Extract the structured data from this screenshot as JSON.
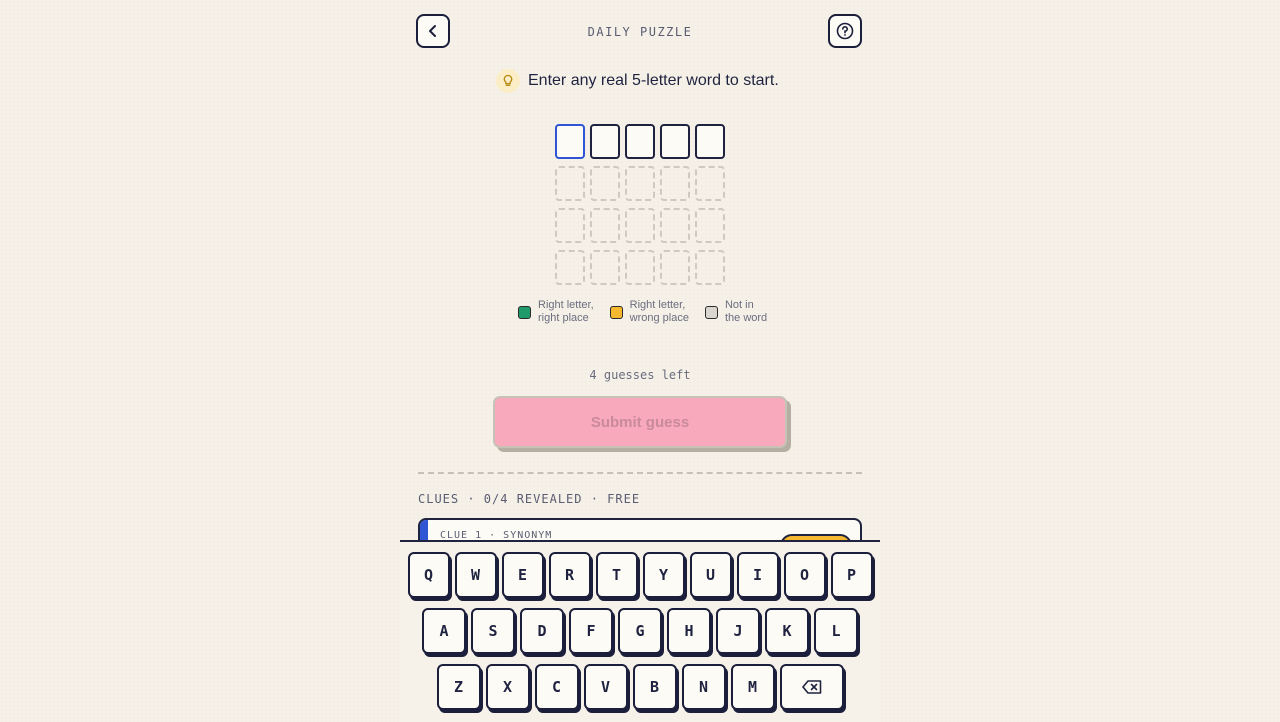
{
  "header": {
    "title": "DAILY PUZZLE",
    "back_icon": "chevron-left-icon",
    "help_icon": "question-circle-icon"
  },
  "hint": {
    "icon": "lightbulb-icon",
    "text": "Enter any real 5-letter word to start."
  },
  "legend": [
    {
      "label": "Right letter,\nright place",
      "color": "#1f9a6a"
    },
    {
      "label": "Right letter,\nwrong place",
      "color": "#f5b82e"
    },
    {
      "label": "Not in\nthe word",
      "color": "#d9d6d0"
    }
  ],
  "status": {
    "guesses_left": "4 guesses left"
  },
  "submit": {
    "label": "Submit guess"
  },
  "clues": {
    "header": "CLUES · 0/4 REVEALED · FREE",
    "first_label": "CLUE 1 · SYNONYM"
  },
  "keyboard": {
    "row1": [
      "Q",
      "W",
      "E",
      "R",
      "T",
      "Y",
      "U",
      "I",
      "O",
      "P"
    ],
    "row2": [
      "A",
      "S",
      "D",
      "F",
      "G",
      "H",
      "J",
      "K",
      "L"
    ],
    "row3": [
      "Z",
      "X",
      "C",
      "V",
      "B",
      "N",
      "M"
    ],
    "backspace_icon": "backspace-icon"
  },
  "colors": {
    "accent": "#2f55d4",
    "submit_bg": "#f9a9bc",
    "ink": "#1f2340"
  }
}
